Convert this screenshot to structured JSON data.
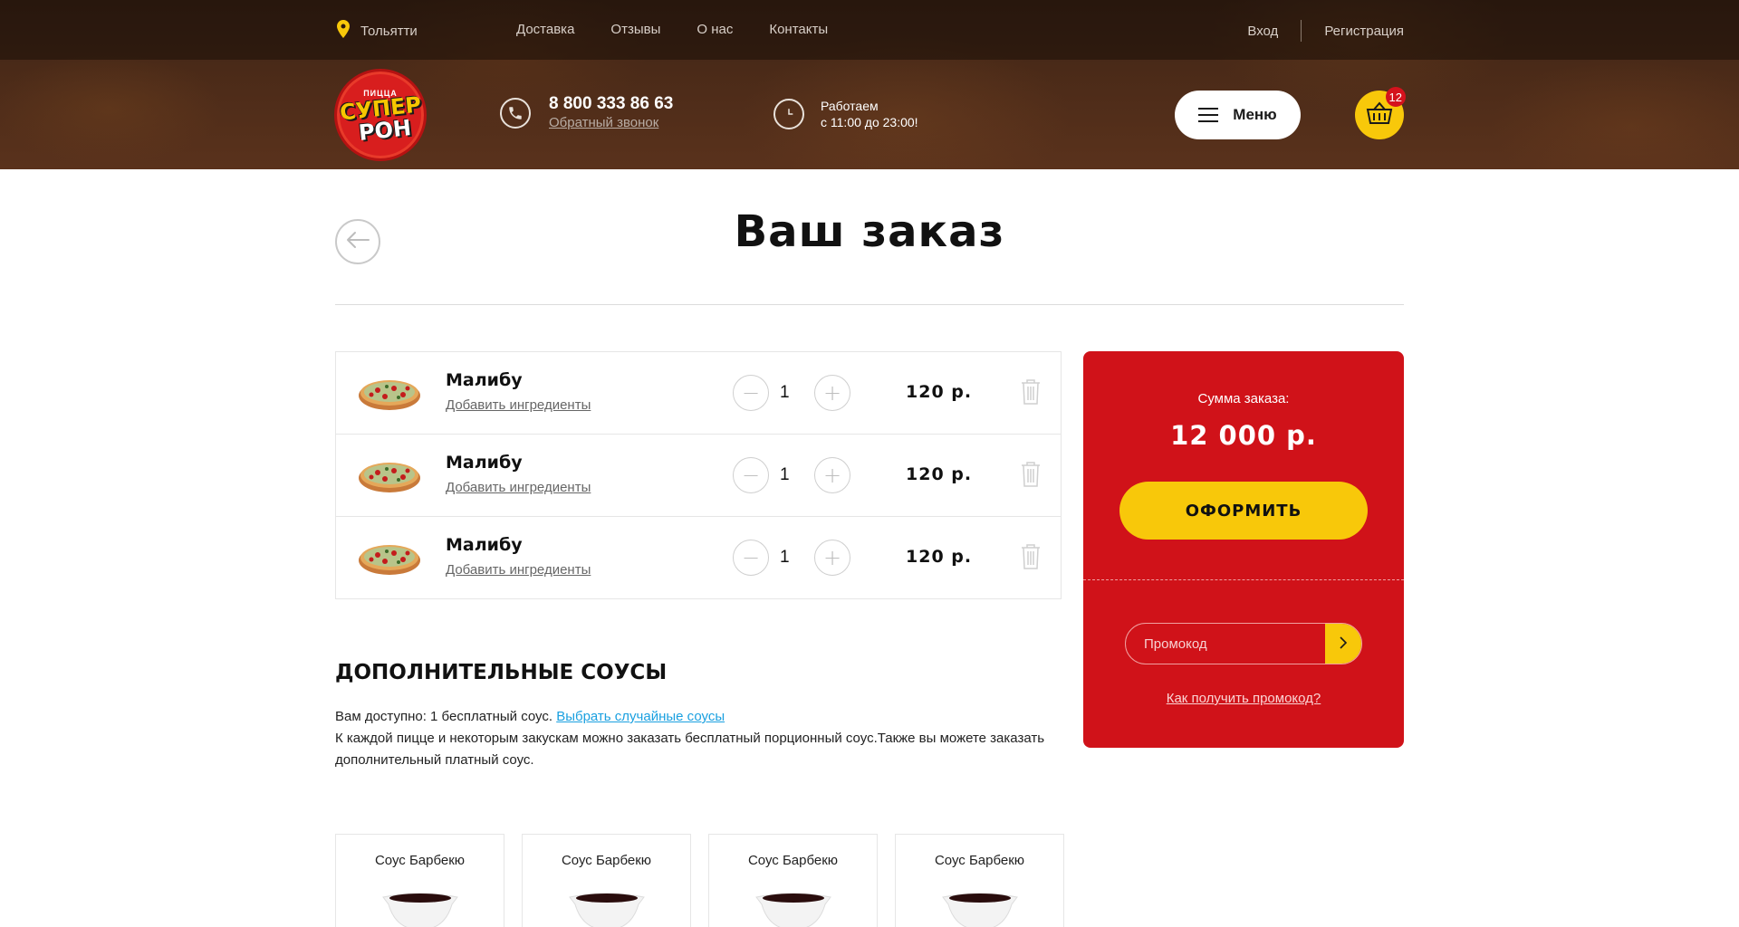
{
  "header": {
    "city": "Тольятти",
    "nav": [
      "Доставка",
      "Отзывы",
      "О нас",
      "Контакты"
    ],
    "login": "Вход",
    "register": "Регистрация",
    "logo": {
      "small": "ПИЦЦА",
      "line1": "СУПЕР",
      "line2": "РОН"
    },
    "phone": "8 800 333 86 63",
    "callback": "Обратный звонок",
    "hours_line1": "Работаем",
    "hours_line2": "с 11:00 до 23:00!",
    "menu_label": "Меню",
    "cart_count": "12"
  },
  "page": {
    "title": "Ваш заказ"
  },
  "order_items": [
    {
      "name": "Малибу",
      "add_link": "Добавить ингредиенты",
      "qty": "1",
      "price": "120 р."
    },
    {
      "name": "Малибу",
      "add_link": "Добавить ингредиенты",
      "qty": "1",
      "price": "120 р."
    },
    {
      "name": "Малибу",
      "add_link": "Добавить ингредиенты",
      "qty": "1",
      "price": "120 р."
    }
  ],
  "sauces": {
    "title": "ДОПОЛНИТЕЛЬНЫЕ СОУСЫ",
    "available": "Вам доступно: 1 бесплатный соус.",
    "random_link": "Выбрать случайные соусы",
    "description": "К каждой пицце и некоторым закускам можно заказать бесплатный порционный соус.Также вы можете заказать дополнительный платный соус.",
    "cards": [
      {
        "name": "Соус Барбекю"
      },
      {
        "name": "Соус Барбекю"
      },
      {
        "name": "Соус Барбекю"
      },
      {
        "name": "Соус Барбекю"
      }
    ]
  },
  "summary": {
    "label": "Сумма заказа:",
    "total": "12 000 р.",
    "checkout": "ОФОРМИТЬ",
    "promo_placeholder": "Промокод",
    "promo_help": "Как получить промокод?"
  },
  "colors": {
    "brand_red": "#d01219",
    "brand_yellow": "#f8c80a",
    "header_brown": "#4a2a18"
  },
  "icons": [
    "location-pin-icon",
    "phone-icon",
    "clock-icon",
    "hamburger-icon",
    "basket-icon",
    "arrow-left-icon",
    "minus-icon",
    "plus-icon",
    "trash-icon",
    "chevron-right-icon"
  ]
}
